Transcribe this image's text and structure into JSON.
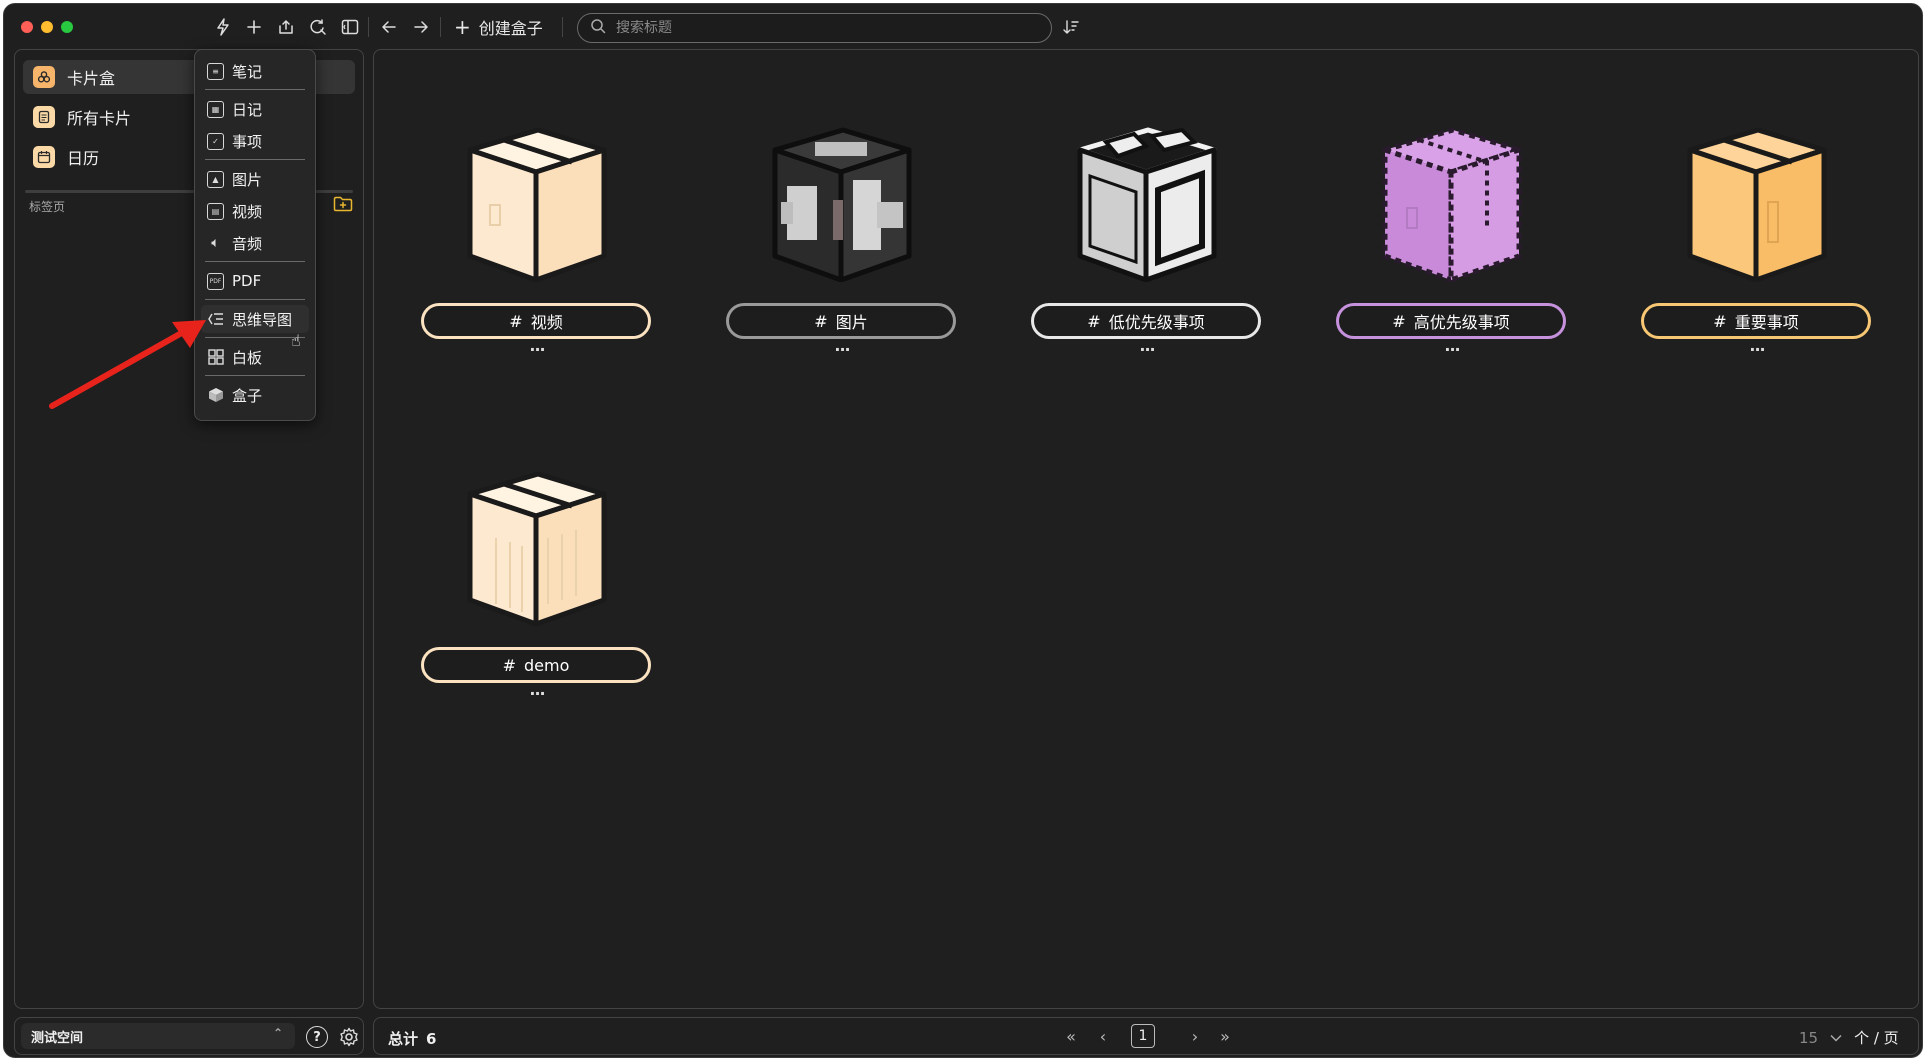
{
  "toolbar": {
    "create_box_label": "创建盒子",
    "search_placeholder": "搜索标题"
  },
  "sidebar": {
    "items": [
      {
        "label": "卡片盒",
        "icon": "card-box-icon",
        "active": true
      },
      {
        "label": "所有卡片",
        "icon": "all-cards-icon",
        "active": false
      },
      {
        "label": "日历",
        "icon": "calendar-icon",
        "active": false
      }
    ],
    "tag_section_label": "标签页"
  },
  "dropdown_menu": {
    "items": [
      {
        "label": "笔记",
        "icon": "note-icon"
      },
      {
        "label": "日记",
        "icon": "diary-icon"
      },
      {
        "label": "事项",
        "icon": "task-icon"
      },
      {
        "label": "图片",
        "icon": "image-icon"
      },
      {
        "label": "视频",
        "icon": "video-icon"
      },
      {
        "label": "音频",
        "icon": "audio-icon"
      },
      {
        "label": "PDF",
        "icon": "pdf-icon"
      },
      {
        "label": "思维导图",
        "icon": "mindmap-icon"
      },
      {
        "label": "白板",
        "icon": "whiteboard-icon"
      },
      {
        "label": "盒子",
        "icon": "box-icon"
      }
    ]
  },
  "boxes": [
    {
      "tag": "视频",
      "pill_color": "#fbe3c2",
      "box_color": "#fde9cf"
    },
    {
      "tag": "图片",
      "pill_color": "#9a9a9a",
      "box_color": "#cfcfcf"
    },
    {
      "tag": "低优先级事项",
      "pill_color": "#e8e8e8",
      "box_color": "#d9d9d9"
    },
    {
      "tag": "高优先级事项",
      "pill_color": "#c792dd",
      "box_color": "#cf8fdf"
    },
    {
      "tag": "重要事项",
      "pill_color": "#f7c774",
      "box_color": "#fbc77a"
    },
    {
      "tag": "demo",
      "pill_color": "#fbe3c2",
      "box_color": "#fde9cf"
    }
  ],
  "tag_prefix": "#",
  "more_label": "···",
  "workspace": {
    "name": "测试空间"
  },
  "footer": {
    "total_label": "总计",
    "total_count": "6",
    "current_page": "1",
    "per_page": "15",
    "per_page_unit": "个 / 页"
  },
  "colors": {
    "window_bg": "#1f1f1f",
    "accent_orange": "#f6b56a",
    "folder_yellow": "#e9b72f",
    "annotation_red": "#e8231c"
  }
}
